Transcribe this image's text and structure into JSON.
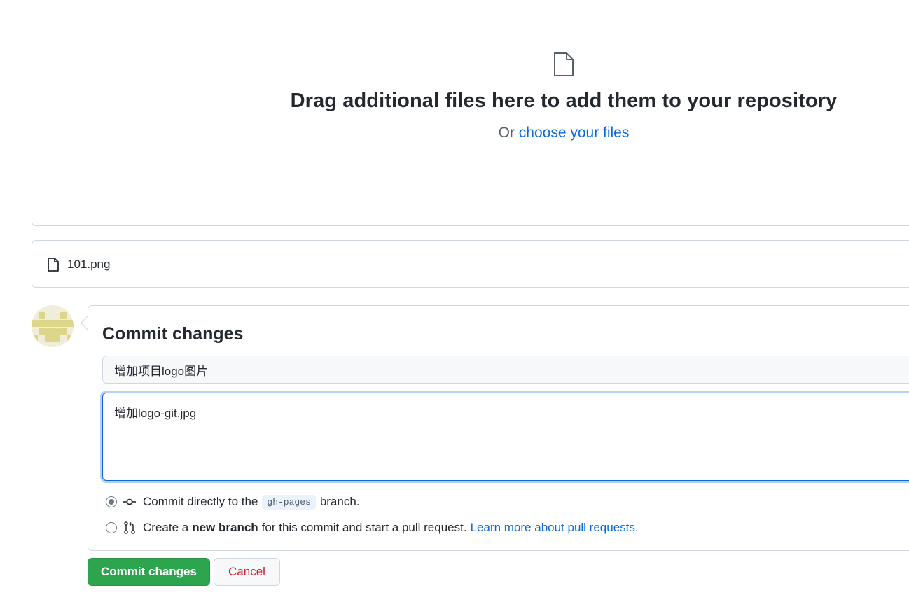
{
  "upload": {
    "title": "Drag additional files here to add them to your repository",
    "or_text": "Or",
    "choose_link": "choose your files"
  },
  "files": [
    {
      "name": "101.png",
      "icon": "file-icon"
    }
  ],
  "commit": {
    "heading": "Commit changes",
    "summary_value": "增加项目logo图片",
    "description_value": "增加logo-git.jpg",
    "options": {
      "direct": {
        "selected": true,
        "icon": "git-commit-icon",
        "prefix": "Commit directly to the",
        "branch": "gh-pages",
        "suffix": "branch."
      },
      "new_branch": {
        "selected": false,
        "icon": "git-pull-request-icon",
        "prefix": "Create a",
        "bold": "new branch",
        "suffix": "for this commit and start a pull request.",
        "link": "Learn more about pull requests."
      }
    }
  },
  "buttons": {
    "commit_label": "Commit changes",
    "cancel_label": "Cancel"
  },
  "colors": {
    "primary_button": "#2da44e",
    "link": "#0969da",
    "cancel_text": "#cf222e",
    "avatar_identicon": "#dcd68a"
  }
}
